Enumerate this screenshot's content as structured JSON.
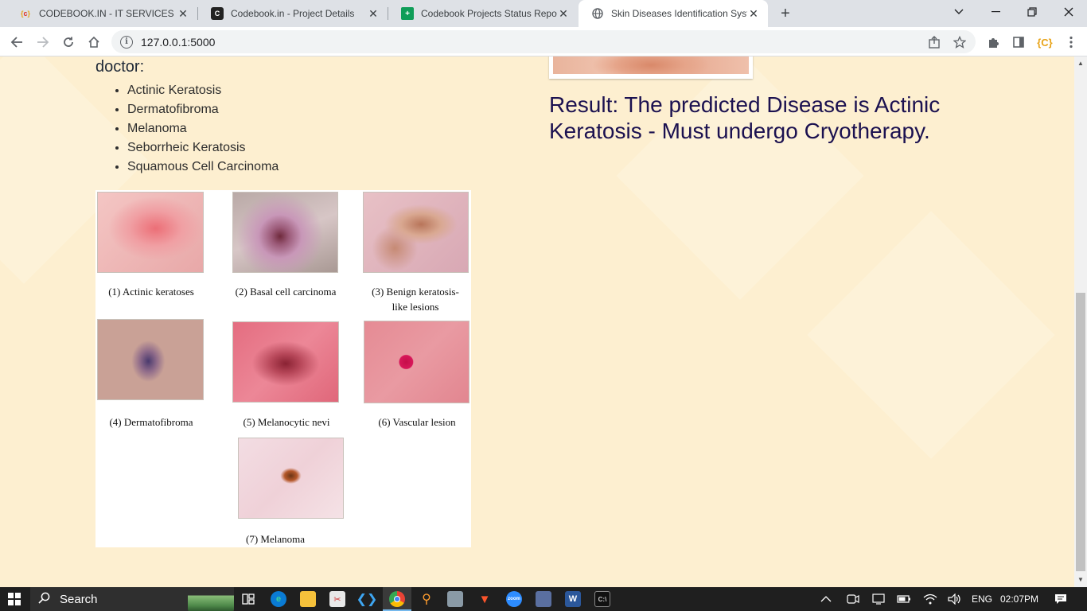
{
  "browser": {
    "tabs": [
      {
        "title": "CODEBOOK.IN - IT SERVICES",
        "favicon": "codebook-logo-icon",
        "active": false
      },
      {
        "title": "Codebook.in - Project Details",
        "favicon": "codebook-dark-icon",
        "active": false
      },
      {
        "title": "Codebook Projects Status Report",
        "favicon": "google-sheets-icon",
        "active": false
      },
      {
        "title": "Skin Diseases Identification Syste",
        "favicon": "globe-icon",
        "active": true
      }
    ],
    "url": "127.0.0.1:5000",
    "extension_label": "{C}"
  },
  "page": {
    "heading_tail": "doctor:",
    "diseases": [
      "Actinic Keratosis",
      "Dermatofibroma",
      "Melanoma",
      "Seborrheic Keratosis",
      "Squamous Cell Carcinoma"
    ],
    "reference_images": [
      {
        "caption_1": "(1)  Actinic keratoses",
        "caption_2": ""
      },
      {
        "caption_1": "(2) Basal cell carcinoma",
        "caption_2": ""
      },
      {
        "caption_1": "(3)  Benign keratosis-",
        "caption_2": "like lesions"
      },
      {
        "caption_1": "(4)  Dermatofibroma",
        "caption_2": ""
      },
      {
        "caption_1": "(5) Melanocytic nevi",
        "caption_2": ""
      },
      {
        "caption_1": "(6)  Vascular lesion",
        "caption_2": ""
      },
      {
        "caption_1": "(7) Melanoma",
        "caption_2": ""
      }
    ],
    "result_text": "Result: The predicted Disease is Actinic Keratosis - Must undergo Cryotherapy."
  },
  "taskbar": {
    "search_label": "Search",
    "language": "ENG",
    "time": "02:07PM"
  },
  "colors": {
    "page_bg": "#fdefd0",
    "result_text": "#1b1150",
    "tabstrip": "#dee1e6",
    "taskbar": "#1f1f1f"
  }
}
